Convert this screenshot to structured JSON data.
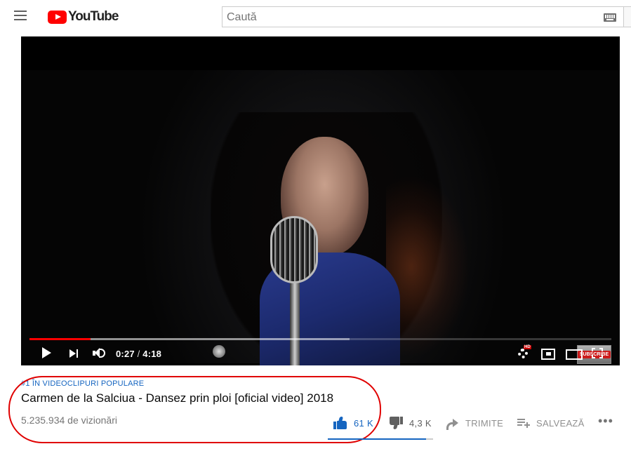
{
  "header": {
    "logo_text": "YouTube",
    "search_placeholder": "Caută"
  },
  "player": {
    "current_time": "0:27",
    "separator": " / ",
    "duration": "4:18",
    "played_fraction": 0.105,
    "loaded_fraction": 0.55,
    "subscribe_badge": "SUBSCRIBE",
    "hd_badge": "HD",
    "accent_color": "#ff0000"
  },
  "video": {
    "hashtag": "#1 ÎN VIDEOCLIPURI POPULARE",
    "title": "Carmen de la Salciua - Dansez prin ploi [oficial video] 2018",
    "views": "5.235.934 de vizionări"
  },
  "actions": {
    "like_count": "61 K",
    "dislike_count": "4,3 K",
    "share_label": "TRIMITE",
    "save_label": "SALVEAZĂ",
    "more_label": "•••",
    "like_ratio": 0.934,
    "like_color": "#1565c0"
  },
  "icons": [
    "menu-icon",
    "youtube-logo-icon",
    "keyboard-icon",
    "play-icon",
    "next-icon",
    "volume-icon",
    "settings-gear-icon",
    "miniplayer-icon",
    "theater-icon",
    "fullscreen-icon",
    "thumb-up-icon",
    "thumb-down-icon",
    "share-icon",
    "save-playlist-icon",
    "more-icon"
  ]
}
